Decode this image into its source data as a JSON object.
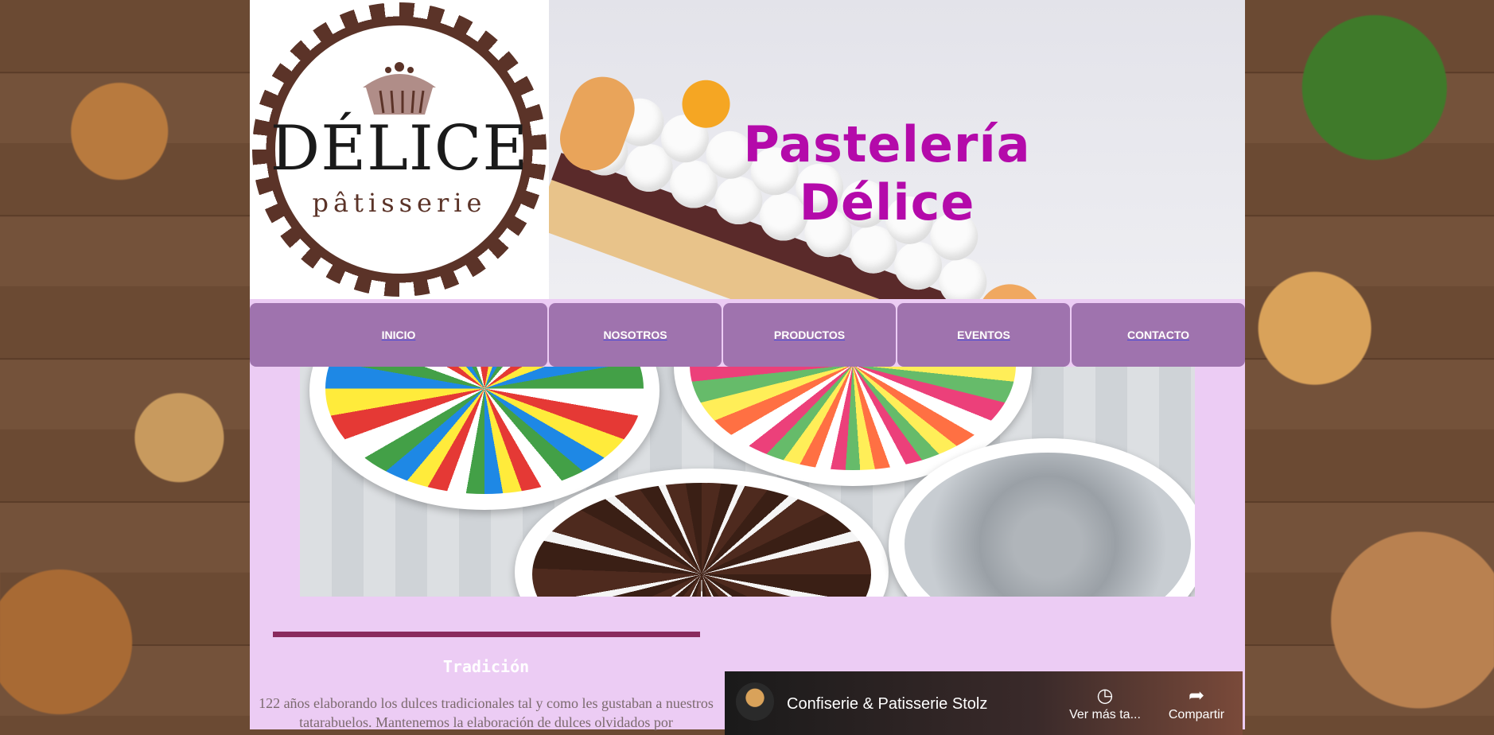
{
  "brand": {
    "logo_name": "DÉLICE",
    "logo_sub": "pâtisserie",
    "site_title": "Pastelería Délice",
    "title_color": "#b40aaa"
  },
  "nav": {
    "items": [
      {
        "label": "INICIO"
      },
      {
        "label": "NOSOTROS"
      },
      {
        "label": "PRODUCTOS"
      },
      {
        "label": "EVENTOS"
      },
      {
        "label": "CONTACTO"
      }
    ],
    "color": "#9f73ae"
  },
  "section": {
    "title": "Tradición",
    "text": "122 años elaborando los dulces tradicionales tal y como les gustaban a nuestros tatarabuelos. Mantenemos la elaboración de dulces olvidados por"
  },
  "video": {
    "title": "Confiserie & Patisserie Stolz",
    "watch_later": "Ver más ta...",
    "share": "Compartir",
    "watch_icon": "clock-icon",
    "share_icon": "share-arrow-icon"
  },
  "colors": {
    "page_bg": "#ecccf4",
    "divider": "#8a2a5e"
  }
}
